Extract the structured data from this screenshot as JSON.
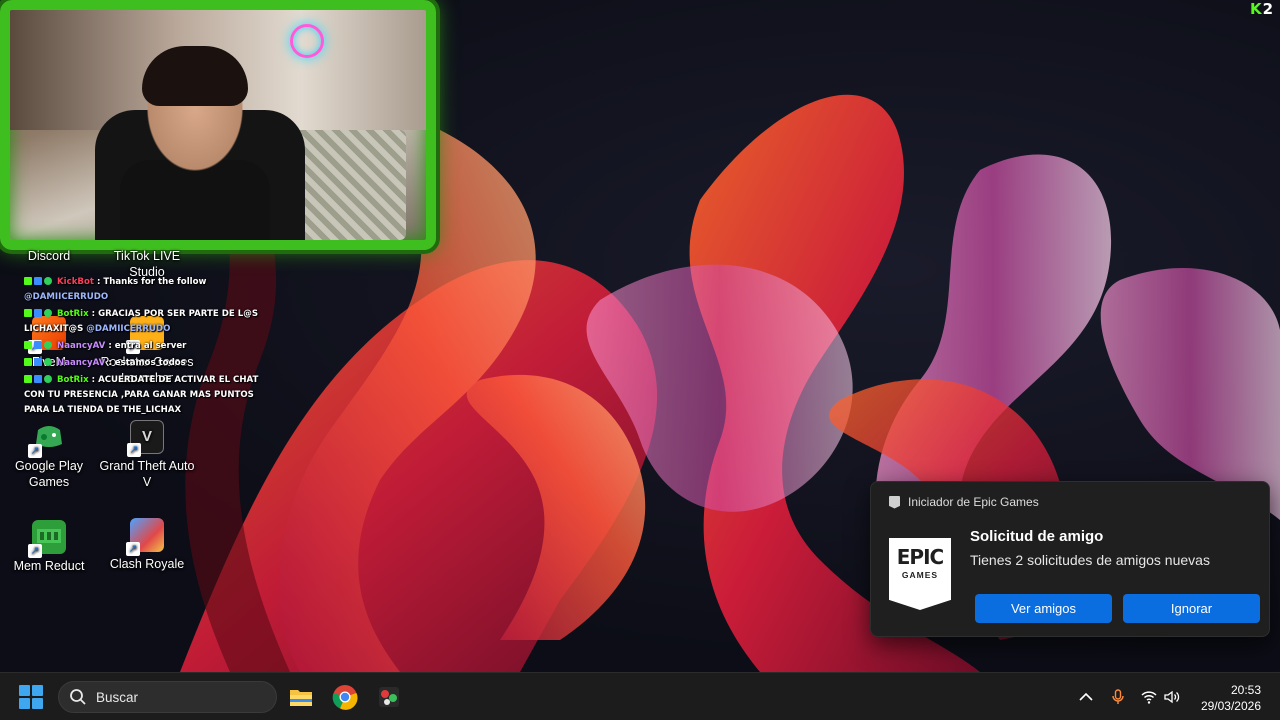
{
  "overlay_logo": {
    "k": "K",
    "two": "2"
  },
  "desktop_icons": [
    {
      "label": "Discord",
      "icon": "discord-icon"
    },
    {
      "label": "TikTok LIVE Studio",
      "icon": "tiktok-live-icon"
    },
    {
      "label": "FiveM",
      "icon": "fivem-icon"
    },
    {
      "label": "Rockstar Games Launcher",
      "icon": "rockstar-icon"
    },
    {
      "label": "Google Play Games",
      "icon": "google-play-games-icon"
    },
    {
      "label": "Grand Theft Auto V",
      "icon": "gta-v-icon"
    },
    {
      "label": "Mem Reduct",
      "icon": "mem-reduct-icon"
    },
    {
      "label": "Clash Royale",
      "icon": "clash-royale-icon"
    }
  ],
  "chat": [
    {
      "user": "KickBot",
      "user_color": "#ff3d5a",
      "text": "Thanks for the follow",
      "mention": "@DAMIICERRUDO",
      "mention_after": ""
    },
    {
      "user": "BotRix",
      "user_color": "#53fc18",
      "text": "GRACIAS POR SER PARTE DE L@S LICHAXIT@S",
      "mention": "@DAMIICERRUDO",
      "mention_after": ""
    },
    {
      "user": "NaancyAV",
      "user_color": "#c98cff",
      "text": "entra al server",
      "mention": "",
      "mention_after": ""
    },
    {
      "user": "NaancyAV",
      "user_color": "#c98cff",
      "text": "estamos todos",
      "mention": "",
      "mention_after": ""
    },
    {
      "user": "BotRix",
      "user_color": "#53fc18",
      "text": "ACUERDATE DE ACTIVAR EL CHAT CON TU PRESENCIA ,PARA GANAR MAS PUNTOS PARA LA TIENDA DE THE_LICHAX",
      "mention": "",
      "mention_after": ""
    }
  ],
  "notification": {
    "app_name": "Iniciador de Epic Games",
    "logo_top": "EPIC",
    "logo_bottom": "GAMES",
    "title": "Solicitud de amigo",
    "body": "Tienes 2 solicitudes de amigos nuevas",
    "primary_button": "Ver amigos",
    "secondary_button": "Ignorar"
  },
  "taskbar": {
    "search_placeholder": "Buscar",
    "pinned": [
      "file-explorer-icon",
      "chrome-icon",
      "game-app-icon"
    ],
    "time": "20:53",
    "date": "29/03/2026"
  },
  "colors": {
    "accent_button": "#0a6ee0",
    "kick_green": "#53fc18",
    "taskbar_bg": "#1c1c1c"
  }
}
